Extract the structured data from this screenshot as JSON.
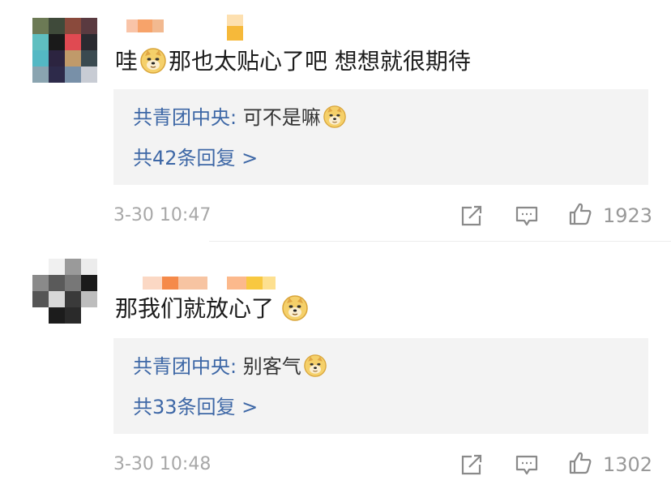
{
  "comments": [
    {
      "text_prefix": "哇",
      "text_suffix": "那也太贴心了吧 想想就很期待",
      "reply": {
        "author": "共青团中央",
        "separator": ": ",
        "text": "可不是嘛",
        "count_label": "共42条回复 >"
      },
      "timestamp": "3-30 10:47",
      "likes": "1923"
    },
    {
      "text_prefix": "那我们就放心了",
      "text_suffix": "",
      "reply": {
        "author": "共青团中央",
        "separator": ": ",
        "text": "别客气",
        "count_label": "共33条回复 >"
      },
      "timestamp": "3-30 10:48",
      "likes": "1302"
    }
  ],
  "icons": {
    "emoji": "doge-emoji-icon",
    "forward": "forward-icon",
    "comment": "comment-icon",
    "like": "thumbs-up-icon"
  },
  "colors": {
    "link": "#3d67a6",
    "reply_bg": "#f3f3f3",
    "meta": "#a8a8a8"
  }
}
